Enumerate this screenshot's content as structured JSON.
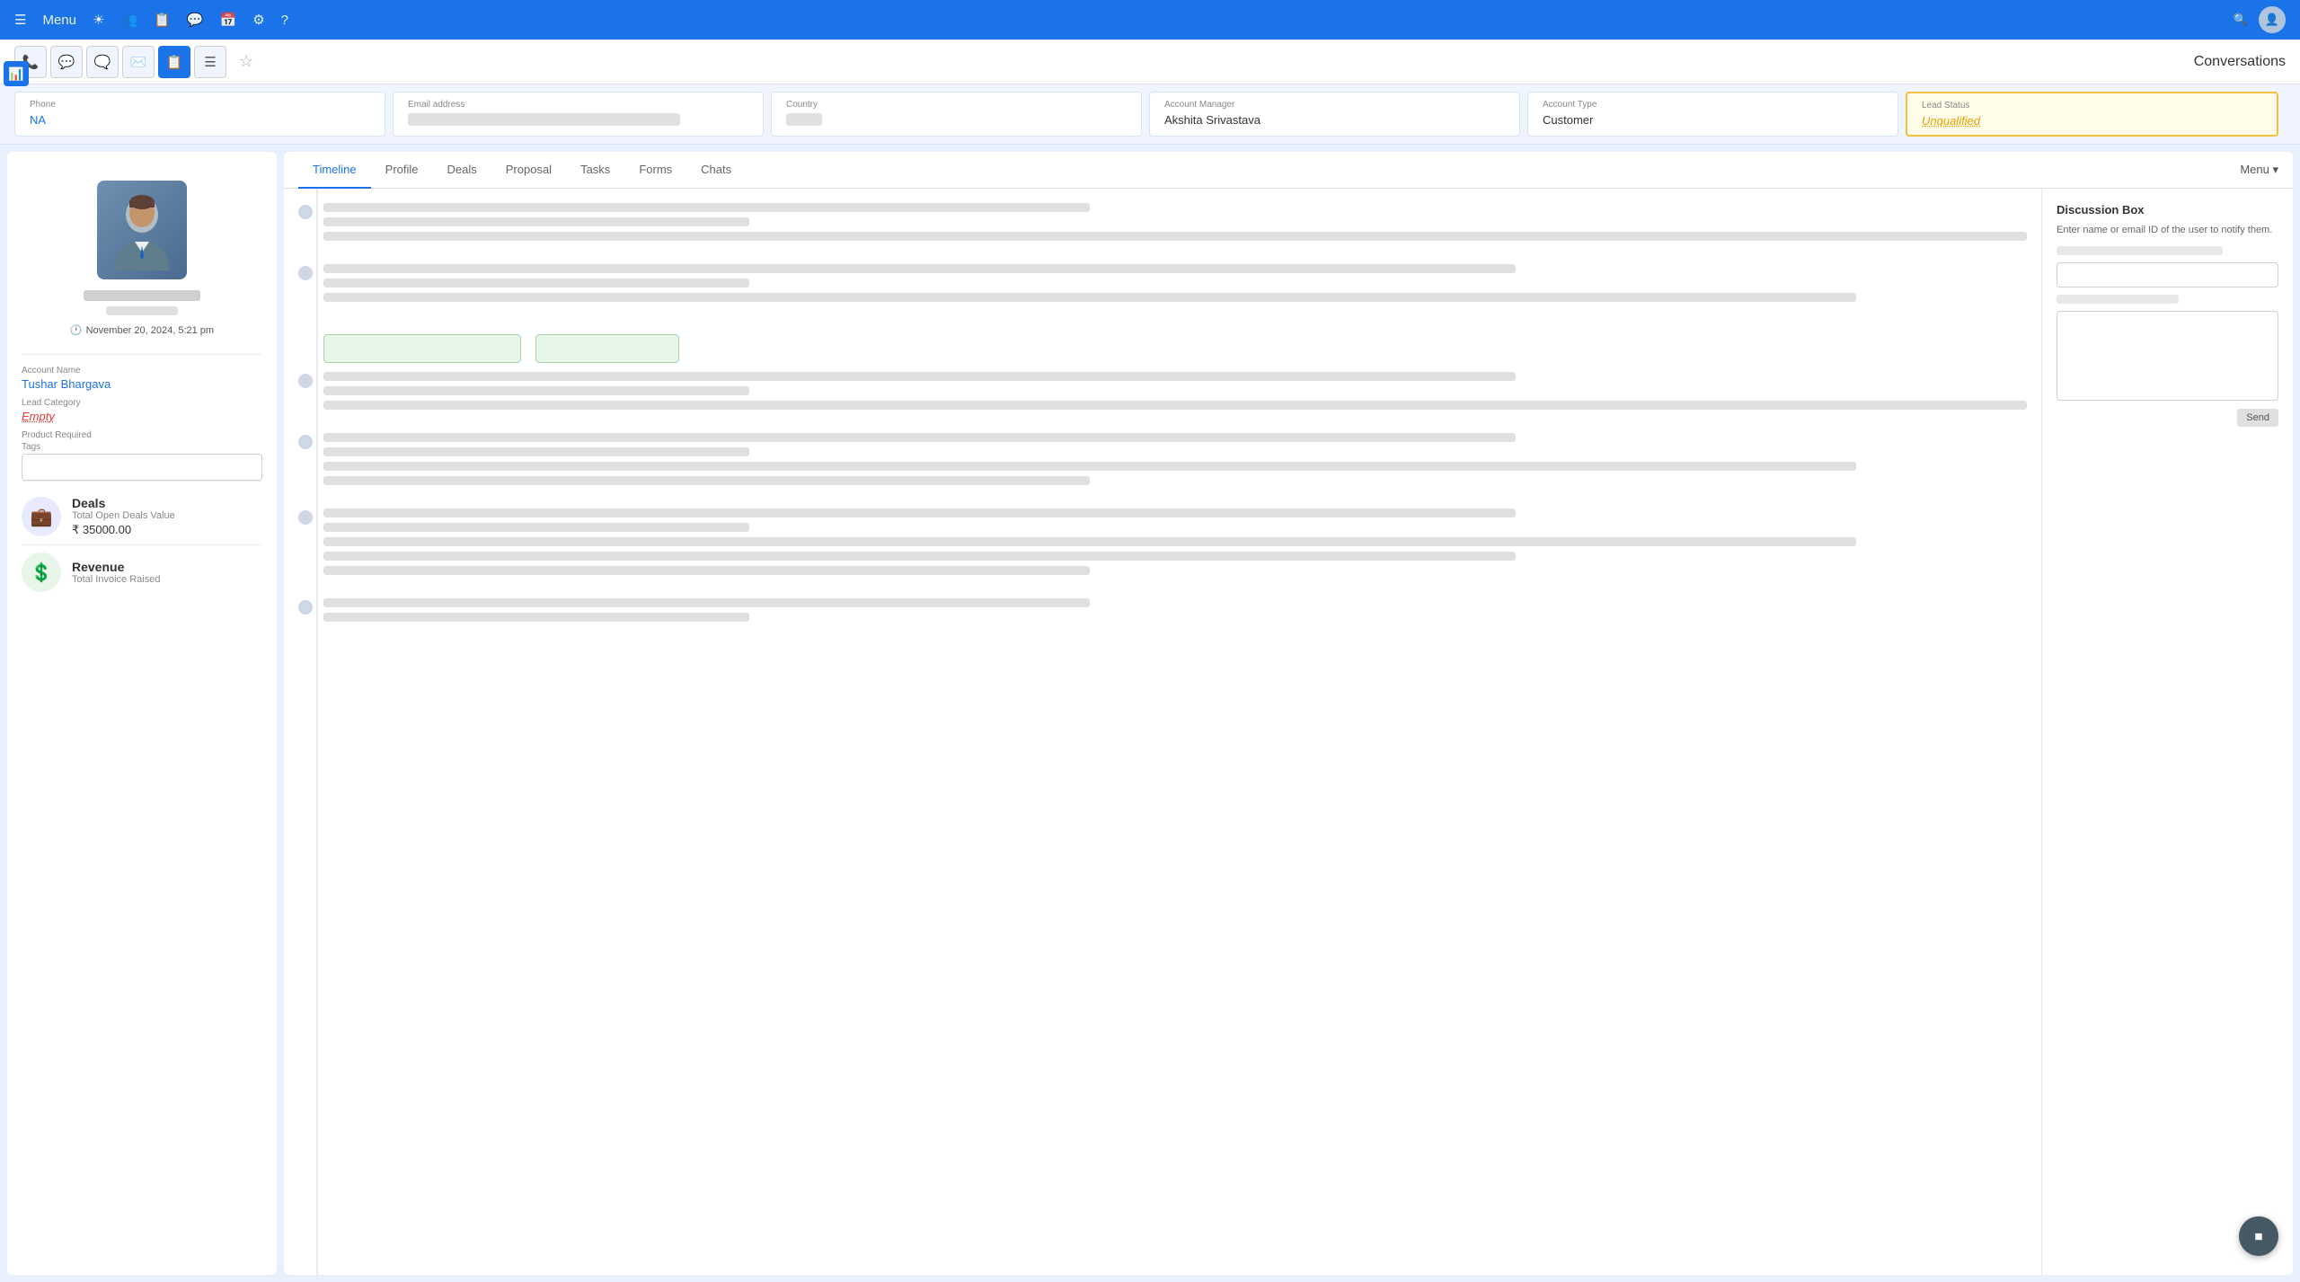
{
  "nav": {
    "menu_label": "Menu",
    "conversations_label": "Conversations"
  },
  "toolbar": {
    "buttons": [
      "📞",
      "💬",
      "🗨️",
      "✉️",
      "📋",
      "☰"
    ],
    "active_index": 4,
    "star_icon": "☆"
  },
  "info_bar": {
    "phone_label": "Phone",
    "phone_value": "NA",
    "email_label": "Email address",
    "country_label": "Country",
    "account_manager_label": "Account Manager",
    "account_manager_value": "Akshita Srivastava",
    "account_type_label": "Account Type",
    "account_type_value": "Customer",
    "lead_status_label": "Lead Status",
    "lead_status_value": "Unqualified"
  },
  "left_panel": {
    "timestamp": "November 20, 2024, 5:21 pm",
    "account_name_label": "Account Name",
    "account_name_value": "Tushar Bhargava",
    "lead_category_label": "Lead Category",
    "lead_category_value": "Empty",
    "product_required_label": "Product Required",
    "tags_label": "Tags",
    "tags_placeholder": "",
    "deals_title": "Deals",
    "deals_subtitle": "Total Open Deals Value",
    "deals_amount": "₹ 35000.00",
    "revenue_title": "Revenue",
    "revenue_subtitle": "Total Invoice Raised"
  },
  "tabs": {
    "items": [
      "Timeline",
      "Profile",
      "Deals",
      "Proposal",
      "Tasks",
      "Forms",
      "Chats"
    ],
    "active_index": 0,
    "menu_label": "Menu ▾"
  },
  "discussion": {
    "title": "Discussion Box",
    "hint": "Enter name or email ID of the user to notify them.",
    "input_placeholder": "",
    "send_label": "Send"
  }
}
